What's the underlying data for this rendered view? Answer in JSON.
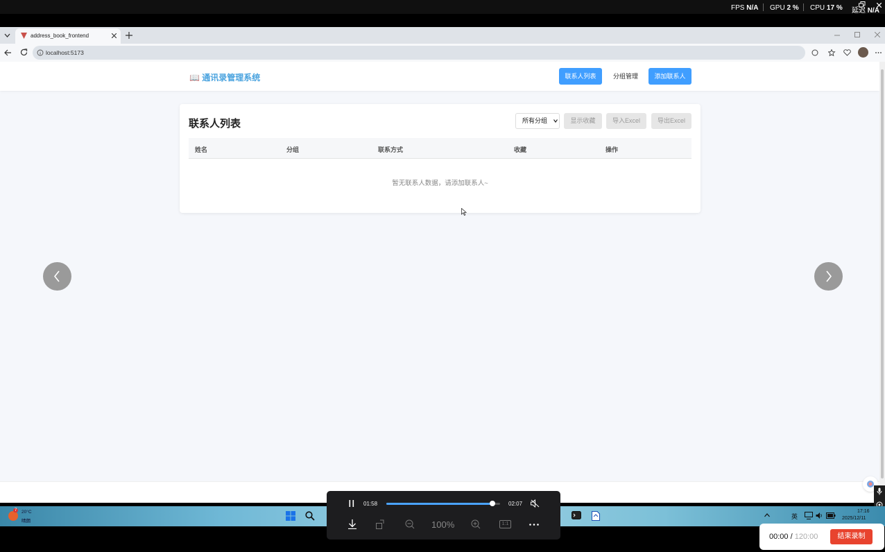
{
  "overlay": {
    "fps_label": "FPS",
    "fps_value": "N/A",
    "gpu_label": "GPU",
    "gpu_value": "2",
    "cpu_label": "CPU",
    "cpu_value": "17",
    "latency_label": "延迟",
    "latency_value": "N/A",
    "percent": "%"
  },
  "browser": {
    "tab_title": "address_book_frontend",
    "url": "localhost:5173"
  },
  "app": {
    "title": "通讯录管理系统",
    "nav": {
      "contacts_list": "联系人列表",
      "group_manage": "分组管理",
      "add_contact": "添加联系人"
    },
    "card": {
      "title": "联系人列表",
      "group_select_value": "所有分组",
      "show_favorites": "显示收藏",
      "import_excel": "导入Excel",
      "export_excel": "导出Excel",
      "columns": [
        "姓名",
        "分组",
        "联系方式",
        "收藏",
        "操作"
      ],
      "empty_message": "暂无联系人数据，请添加联系人~"
    }
  },
  "player": {
    "current_time": "01:58",
    "total_time": "02:07",
    "progress": 0.93,
    "zoom": "100%",
    "ratio_label": "1:1"
  },
  "taskbar": {
    "weather_temp": "20°C",
    "weather_desc": "晴朗",
    "ime": "英",
    "clock_time": "17:16",
    "clock_date": "2025/12/11",
    "badge": "7"
  },
  "recording": {
    "elapsed": "00:00",
    "separator": " / ",
    "limit": "120:00",
    "stop_label": "结束录制"
  },
  "colors": {
    "primary": "#409eff",
    "title_blue": "#4aa3df",
    "stop_red": "#e8432e"
  }
}
